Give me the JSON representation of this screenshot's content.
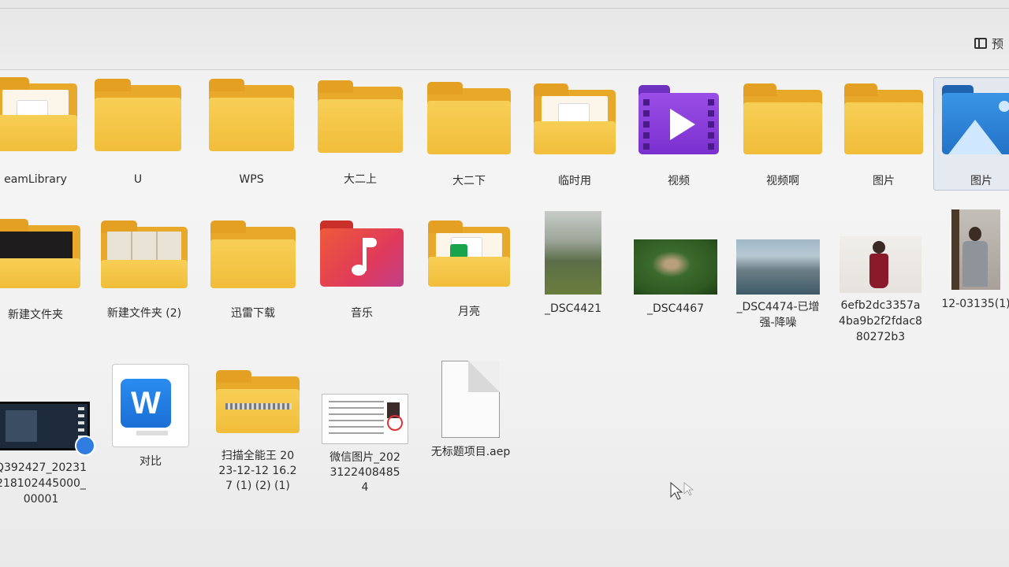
{
  "toolbar": {
    "preview_label": "预"
  },
  "row1": [
    {
      "label": "eamLibrary",
      "type": "folder-doc"
    },
    {
      "label": "U",
      "type": "folder"
    },
    {
      "label": "WPS",
      "type": "folder"
    },
    {
      "label": "大二上",
      "type": "folder"
    },
    {
      "label": "大二下",
      "type": "folder"
    },
    {
      "label": "临时用",
      "type": "folder-doc"
    },
    {
      "label": "视频",
      "type": "videos-folder"
    },
    {
      "label": "视频啊",
      "type": "folder"
    },
    {
      "label": "图片",
      "type": "folder"
    },
    {
      "label": "图片",
      "type": "pictures-folder"
    }
  ],
  "row2": [
    {
      "label": "新建文件夹",
      "type": "folder-dark"
    },
    {
      "label": "新建文件夹 (2)",
      "type": "folder-papers"
    },
    {
      "label": "迅雷下载",
      "type": "folder"
    },
    {
      "label": "音乐",
      "type": "music-folder"
    },
    {
      "label": "月亮",
      "type": "folder-app"
    },
    {
      "label": "_DSC4421",
      "type": "photo"
    },
    {
      "label": "_DSC4467",
      "type": "photo"
    },
    {
      "label": "_DSC4474-已增强-降噪",
      "type": "photo"
    },
    {
      "label": "6efb2dc3357a4ba9b2f2fdac880272b3",
      "type": "photo"
    },
    {
      "label": "12-03135(1)",
      "type": "photo"
    }
  ],
  "row3": [
    {
      "label": "Q392427_20231218102445000_00001",
      "type": "video"
    },
    {
      "label": "对比",
      "type": "wps-doc"
    },
    {
      "label": "扫描全能王 2023-12-12 16.27 (1) (2) (1)",
      "type": "zip-folder"
    },
    {
      "label": "微信图片_20231224084854",
      "type": "document-image"
    },
    {
      "label": "无标题项目.aep",
      "type": "blank-file"
    }
  ],
  "colors": {
    "folder_front": "#f3c445",
    "folder_back": "#e8a82a",
    "video_purple": "#8a3fd6",
    "music_red": "#e8453c",
    "pictures_blue": "#2a7fd4",
    "wps_blue": "#1e7ee8"
  }
}
